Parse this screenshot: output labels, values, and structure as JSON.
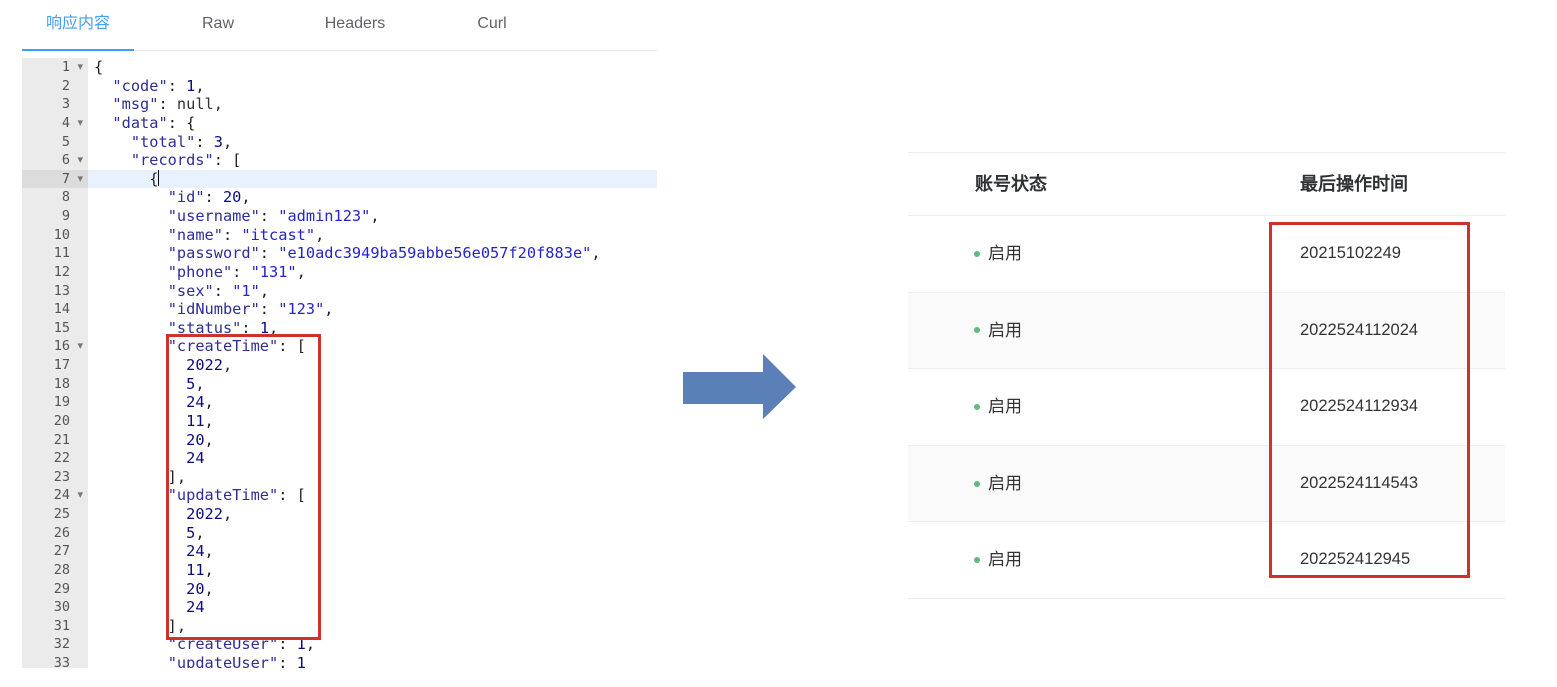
{
  "tabs": [
    {
      "label": "响应内容",
      "active": true
    },
    {
      "label": "Raw",
      "active": false
    },
    {
      "label": "Headers",
      "active": false
    },
    {
      "label": "Curl",
      "active": false
    }
  ],
  "editor": {
    "active_line": 7,
    "lines": [
      {
        "no": "1",
        "text": "{",
        "fold": true
      },
      {
        "no": "2",
        "text": "  \"code\": 1,"
      },
      {
        "no": "3",
        "text": "  \"msg\": null,"
      },
      {
        "no": "4",
        "text": "  \"data\": {",
        "fold": true
      },
      {
        "no": "5",
        "text": "    \"total\": 3,"
      },
      {
        "no": "6",
        "text": "    \"records\": [",
        "fold": true
      },
      {
        "no": "7",
        "text": "      {",
        "fold": true
      },
      {
        "no": "8",
        "text": "        \"id\": 20,"
      },
      {
        "no": "9",
        "text": "        \"username\": \"admin123\","
      },
      {
        "no": "10",
        "text": "        \"name\": \"itcast\","
      },
      {
        "no": "11",
        "text": "        \"password\": \"e10adc3949ba59abbe56e057f20f883e\","
      },
      {
        "no": "12",
        "text": "        \"phone\": \"131\","
      },
      {
        "no": "13",
        "text": "        \"sex\": \"1\","
      },
      {
        "no": "14",
        "text": "        \"idNumber\": \"123\","
      },
      {
        "no": "15",
        "text": "        \"status\": 1,"
      },
      {
        "no": "16",
        "text": "        \"createTime\": [",
        "fold": true
      },
      {
        "no": "17",
        "text": "          2022,"
      },
      {
        "no": "18",
        "text": "          5,"
      },
      {
        "no": "19",
        "text": "          24,"
      },
      {
        "no": "20",
        "text": "          11,"
      },
      {
        "no": "21",
        "text": "          20,"
      },
      {
        "no": "22",
        "text": "          24"
      },
      {
        "no": "23",
        "text": "        ],"
      },
      {
        "no": "24",
        "text": "        \"updateTime\": [",
        "fold": true
      },
      {
        "no": "25",
        "text": "          2022,"
      },
      {
        "no": "26",
        "text": "          5,"
      },
      {
        "no": "27",
        "text": "          24,"
      },
      {
        "no": "28",
        "text": "          11,"
      },
      {
        "no": "29",
        "text": "          20,"
      },
      {
        "no": "30",
        "text": "          24"
      },
      {
        "no": "31",
        "text": "        ],"
      },
      {
        "no": "32",
        "text": "        \"createUser\": 1,"
      },
      {
        "no": "33",
        "text": "        \"updateUser\": 1"
      }
    ]
  },
  "table": {
    "columns": [
      "账号状态",
      "最后操作时间"
    ],
    "rows": [
      {
        "status": "启用",
        "time": "20215102249"
      },
      {
        "status": "启用",
        "time": "2022524112024"
      },
      {
        "status": "启用",
        "time": "2022524112934"
      },
      {
        "status": "启用",
        "time": "2022524114543"
      },
      {
        "status": "启用",
        "time": "202252412945"
      }
    ]
  },
  "icons": {
    "fold_marker": "chevron-down-icon",
    "status_indicator": "status-dot-icon",
    "flow_arrow": "right-arrow-icon"
  },
  "colors": {
    "accent": "#409eff",
    "annotation_red": "#d0312d",
    "arrow_blue": "#5b7fb7",
    "status_green": "#5fbb7b",
    "active_line_bg": "#e8f2ff"
  }
}
